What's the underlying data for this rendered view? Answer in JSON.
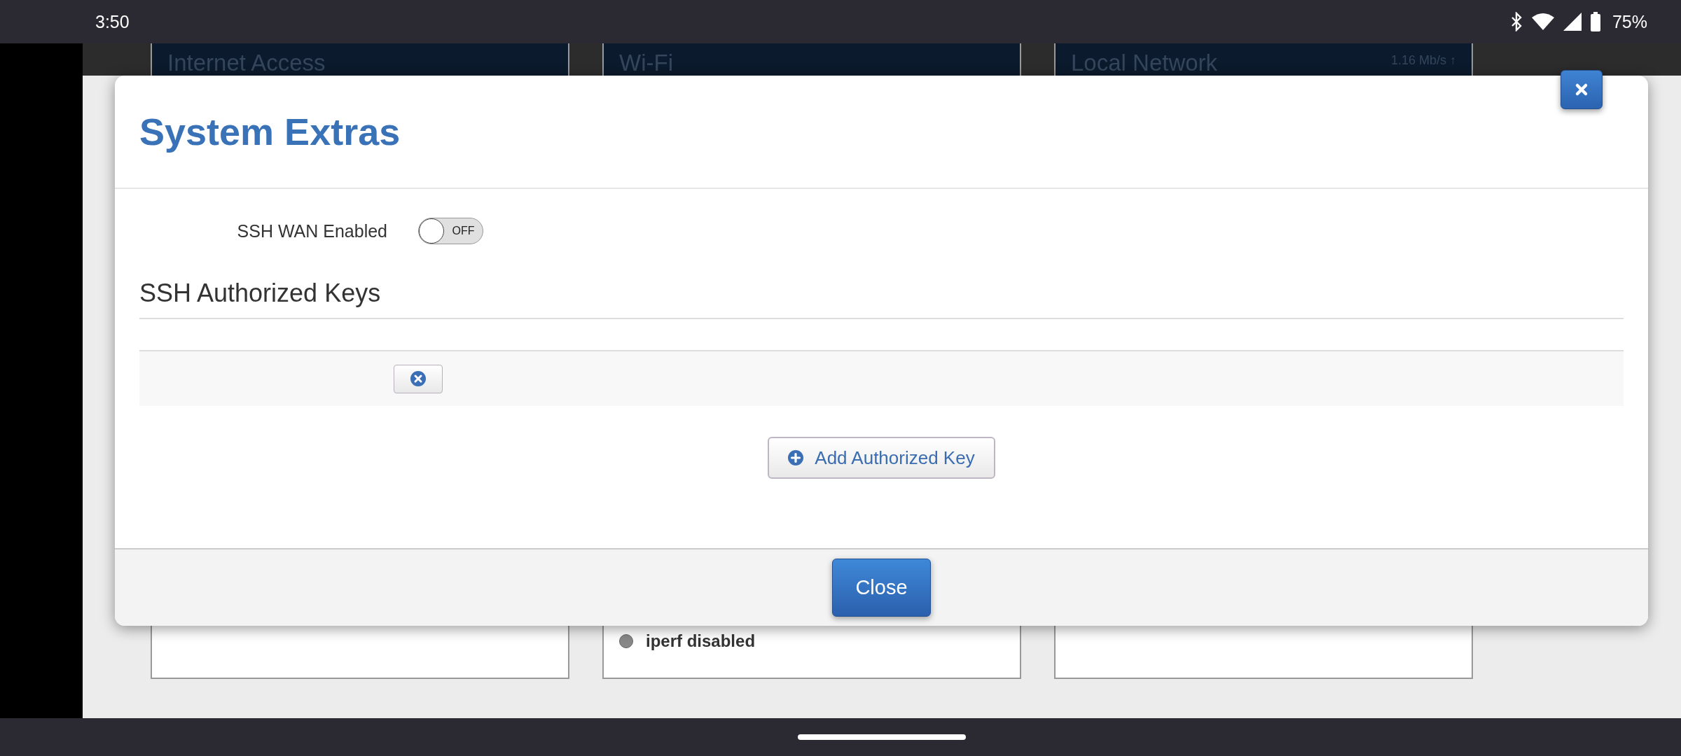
{
  "status_bar": {
    "time": "3:50",
    "battery": "75%"
  },
  "background": {
    "cards": [
      {
        "title": "Internet Access"
      },
      {
        "title": "Wi-Fi",
        "status": "iperf disabled"
      },
      {
        "title": "Local Network",
        "rate": "1.16 Mb/s ↑"
      }
    ]
  },
  "dialog": {
    "title": "System Extras",
    "ssh_wan": {
      "label": "SSH WAN Enabled",
      "on": false,
      "state_label": "OFF"
    },
    "keys_heading": "SSH Authorized Keys",
    "add_button": "Add Authorized Key",
    "close_button": "Close"
  }
}
